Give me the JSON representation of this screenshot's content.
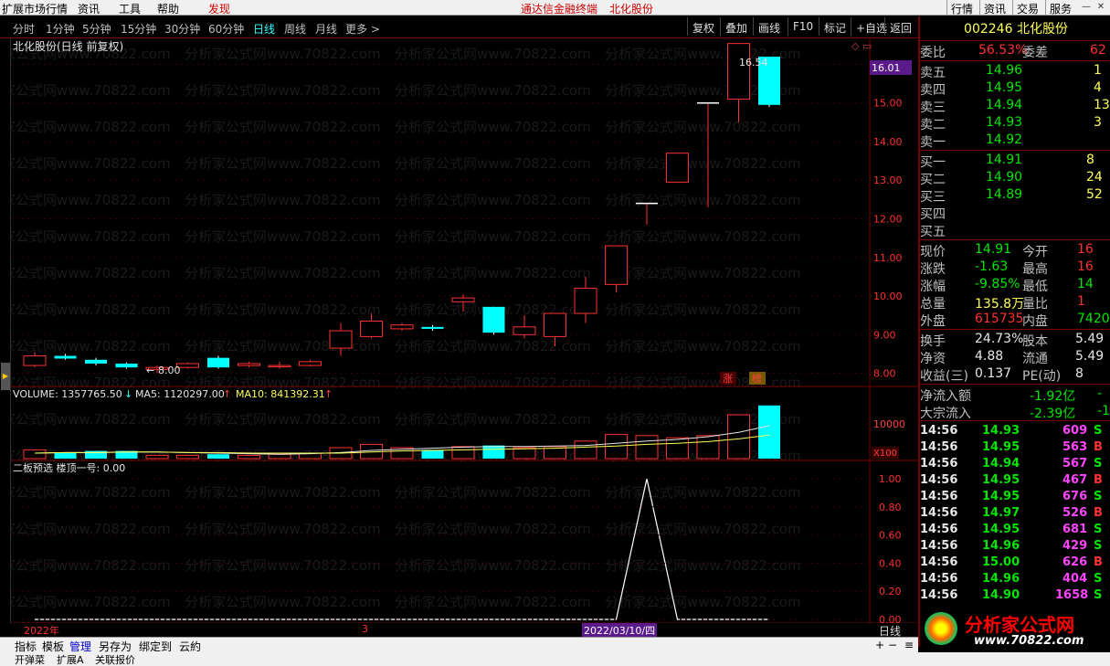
{
  "menubar": {
    "items": [
      "扩展市场行情",
      "资讯",
      "工具",
      "帮助"
    ],
    "find": "发现",
    "center_title": "通达信金融终端",
    "center_stock": "北化股份",
    "right_buttons": [
      "行情",
      "资讯",
      "交易",
      "服务"
    ]
  },
  "toolbar": {
    "periods": [
      "分时",
      "1分钟",
      "5分钟",
      "15分钟",
      "30分钟",
      "60分钟",
      "日线",
      "周线",
      "月线",
      "更多 >"
    ],
    "active_period": "日线",
    "buttons": [
      "复权",
      "叠加",
      "画线",
      "F10",
      "标记",
      "+自选",
      "返回"
    ]
  },
  "chart": {
    "title": "北化股份(日线 前复权)",
    "price_ticks": [
      "16.00",
      "15.00",
      "14.00",
      "13.00",
      "12.00",
      "11.00",
      "10.00",
      "9.00",
      "8.00"
    ],
    "current_price_label": "16.01",
    "high_label": "16.54",
    "low_label": "8.00",
    "badge_zhang": "涨",
    "badge_bang": "榜",
    "volume_label": "VOLUME: 1357765.50",
    "ma5_label": "MA5: 1120297.00",
    "ma10_label": "MA10: 841392.31",
    "volume_tick": "10000",
    "volume_unit": "X100",
    "indicator_label": "二板预选  楼顶一号: 0.00",
    "indicator_ticks": [
      "1.00",
      "0.80",
      "0.60",
      "0.40",
      "0.20",
      "0.00"
    ],
    "date_year": "2022年",
    "date_month": "3",
    "date_cursor": "2022/03/10/四",
    "axis_mode": "日线",
    "watermark": "分析家公式网www.70822.com"
  },
  "chart_data": {
    "type": "candlestick",
    "candles": [
      {
        "o": 8.2,
        "c": 8.45,
        "h": 8.55,
        "l": 8.15,
        "up": true
      },
      {
        "o": 8.45,
        "c": 8.38,
        "h": 8.5,
        "l": 8.35,
        "up": false
      },
      {
        "o": 8.35,
        "c": 8.25,
        "h": 8.4,
        "l": 8.2,
        "up": false
      },
      {
        "o": 8.25,
        "c": 8.15,
        "h": 8.28,
        "l": 8.12,
        "up": false
      },
      {
        "o": 8.1,
        "c": 8.15,
        "h": 8.2,
        "l": 8.0,
        "up": true
      },
      {
        "o": 8.15,
        "c": 8.25,
        "h": 8.28,
        "l": 8.12,
        "up": true
      },
      {
        "o": 8.4,
        "c": 8.15,
        "h": 8.45,
        "l": 8.12,
        "up": false
      },
      {
        "o": 8.2,
        "c": 8.25,
        "h": 8.3,
        "l": 8.15,
        "up": true
      },
      {
        "o": 8.18,
        "c": 8.2,
        "h": 8.3,
        "l": 8.12,
        "up": true
      },
      {
        "o": 8.2,
        "c": 8.3,
        "h": 8.35,
        "l": 8.18,
        "up": true
      },
      {
        "o": 8.65,
        "c": 9.1,
        "h": 9.3,
        "l": 8.45,
        "up": true
      },
      {
        "o": 8.95,
        "c": 9.35,
        "h": 9.55,
        "l": 8.9,
        "up": true
      },
      {
        "o": 9.15,
        "c": 9.25,
        "h": 9.3,
        "l": 9.1,
        "up": true
      },
      {
        "o": 9.2,
        "c": 9.15,
        "h": 9.25,
        "l": 9.1,
        "up": false
      },
      {
        "o": 9.85,
        "c": 9.95,
        "h": 10.05,
        "l": 9.6,
        "up": true
      },
      {
        "o": 9.72,
        "c": 9.05,
        "h": 9.72,
        "l": 9.0,
        "up": false
      },
      {
        "o": 9.0,
        "c": 9.2,
        "h": 9.5,
        "l": 8.9,
        "up": true
      },
      {
        "o": 8.95,
        "c": 9.55,
        "h": 9.55,
        "l": 8.7,
        "up": true
      },
      {
        "o": 9.55,
        "c": 10.2,
        "h": 10.5,
        "l": 9.3,
        "up": true
      },
      {
        "o": 10.3,
        "c": 11.3,
        "h": 11.3,
        "l": 10.1,
        "up": true
      },
      {
        "o": 12.4,
        "c": 12.4,
        "h": 12.4,
        "l": 11.85,
        "up": true
      },
      {
        "o": 12.95,
        "c": 13.7,
        "h": 13.7,
        "l": 12.95,
        "up": true
      },
      {
        "o": 15.0,
        "c": 15.0,
        "h": 15.0,
        "l": 12.3,
        "up": true
      },
      {
        "o": 15.1,
        "c": 16.54,
        "h": 16.54,
        "l": 14.5,
        "up": true
      },
      {
        "o": 16.2,
        "c": 14.95,
        "h": 16.2,
        "l": 14.9,
        "up": false
      }
    ],
    "volume": [
      16,
      10,
      14,
      14,
      6,
      6,
      8,
      6,
      8,
      10,
      20,
      26,
      20,
      16,
      22,
      24,
      20,
      22,
      32,
      44,
      42,
      38,
      42,
      80,
      97
    ],
    "ma5": [
      10,
      11,
      11,
      12,
      12,
      11,
      10,
      9,
      8,
      9,
      11,
      15,
      17,
      19,
      21,
      22,
      22,
      23,
      24,
      28,
      32,
      35,
      40,
      48,
      60
    ],
    "ma10": [
      10,
      11,
      11,
      12,
      12,
      11,
      11,
      10,
      10,
      10,
      10,
      12,
      14,
      15,
      16,
      17,
      18,
      19,
      21,
      23,
      26,
      28,
      31,
      36,
      43
    ],
    "indicator": [
      0,
      0,
      0,
      0,
      0,
      0,
      0,
      0,
      0,
      0,
      0,
      0,
      0,
      0,
      0,
      0,
      0,
      0,
      0,
      0,
      1,
      0,
      0,
      0,
      0
    ],
    "ylim": [
      7.8,
      16.2
    ]
  },
  "quote": {
    "code": "002246",
    "name": "北化股份",
    "weibi_label": "委比",
    "weibi": "56.53%",
    "weicha_label": "委差",
    "weicha": "62",
    "asks": [
      {
        "label": "卖五",
        "price": "14.96",
        "vol": "1"
      },
      {
        "label": "卖四",
        "price": "14.95",
        "vol": "4"
      },
      {
        "label": "卖三",
        "price": "14.94",
        "vol": "13"
      },
      {
        "label": "卖二",
        "price": "14.93",
        "vol": "3"
      },
      {
        "label": "卖一",
        "price": "14.92",
        "vol": ""
      }
    ],
    "bids": [
      {
        "label": "买一",
        "price": "14.91",
        "vol": "8"
      },
      {
        "label": "买二",
        "price": "14.90",
        "vol": "24"
      },
      {
        "label": "买三",
        "price": "14.89",
        "vol": "52"
      },
      {
        "label": "买四",
        "price": "",
        "vol": ""
      },
      {
        "label": "买五",
        "price": "",
        "vol": ""
      }
    ],
    "stats": [
      {
        "l1": "现价",
        "v1": "14.91",
        "c1": "g",
        "l2": "今开",
        "v2": "16",
        "c2": "r"
      },
      {
        "l1": "涨跌",
        "v1": "-1.63",
        "c1": "g",
        "l2": "最高",
        "v2": "16",
        "c2": "r"
      },
      {
        "l1": "涨幅",
        "v1": "-9.85%",
        "c1": "g",
        "l2": "最低",
        "v2": "14",
        "c2": "g"
      },
      {
        "l1": "总量",
        "v1": "135.8万",
        "c1": "y",
        "l2": "量比",
        "v2": "1",
        "c2": "r"
      },
      {
        "l1": "外盘",
        "v1": "615735",
        "c1": "r",
        "l2": "内盘",
        "v2": "7420",
        "c2": "g"
      }
    ],
    "stats2": [
      {
        "l1": "换手",
        "v1": "24.73%",
        "c1": "w",
        "l2": "股本",
        "v2": "5.49",
        "c2": "w"
      },
      {
        "l1": "净资",
        "v1": "4.88",
        "c1": "w",
        "l2": "流通",
        "v2": "5.49",
        "c2": "w"
      },
      {
        "l1": "收益(三)",
        "v1": "0.137",
        "c1": "w",
        "l2": "PE(动)",
        "v2": "8",
        "c2": "w"
      }
    ],
    "flow": [
      {
        "label": "净流入额",
        "value": "-1.92亿",
        "extra": "-"
      },
      {
        "label": "大宗流入",
        "value": "-2.39亿",
        "extra": "-1"
      }
    ],
    "ticks": [
      {
        "t": "14:56",
        "p": "14.93",
        "v": "609",
        "d": "S"
      },
      {
        "t": "14:56",
        "p": "14.95",
        "v": "563",
        "d": "B"
      },
      {
        "t": "14:56",
        "p": "14.94",
        "v": "567",
        "d": "S"
      },
      {
        "t": "14:56",
        "p": "14.95",
        "v": "467",
        "d": "B"
      },
      {
        "t": "14:56",
        "p": "14.95",
        "v": "676",
        "d": "S"
      },
      {
        "t": "14:56",
        "p": "14.97",
        "v": "526",
        "d": "B"
      },
      {
        "t": "14:56",
        "p": "14.95",
        "v": "681",
        "d": "S"
      },
      {
        "t": "14:56",
        "p": "14.96",
        "v": "429",
        "d": "S"
      },
      {
        "t": "14:56",
        "p": "15.00",
        "v": "626",
        "d": "B"
      },
      {
        "t": "14:56",
        "p": "14.96",
        "v": "404",
        "d": "S"
      },
      {
        "t": "14:56",
        "p": "14.90",
        "v": "1658",
        "d": "S"
      }
    ]
  },
  "bottombar": {
    "buttons": [
      "指标",
      "模板",
      "管理",
      "另存为",
      "绑定到",
      "云約"
    ],
    "active": "管理"
  },
  "statusbar": {
    "items": [
      "开弹菜",
      "扩展A",
      "关联报价"
    ]
  },
  "logo": {
    "title": "分析家公式网",
    "url": "www.70822.com"
  },
  "colors": {
    "up": "#ff3030",
    "down": "#00ffff",
    "bg": "#000000",
    "grid": "#7a0000"
  }
}
